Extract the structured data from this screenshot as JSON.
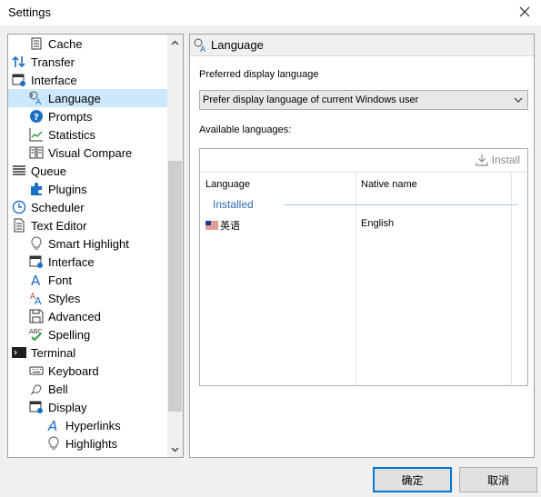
{
  "window": {
    "title": "Settings"
  },
  "tree": {
    "items": [
      {
        "label": "Cache",
        "icon": "cache-icon"
      },
      {
        "label": "Transfer",
        "icon": "transfer-icon"
      },
      {
        "label": "Interface",
        "icon": "interface-icon"
      },
      {
        "label": "Language",
        "icon": "language-icon",
        "selected": true
      },
      {
        "label": "Prompts",
        "icon": "prompts-icon"
      },
      {
        "label": "Statistics",
        "icon": "statistics-icon"
      },
      {
        "label": "Visual Compare",
        "icon": "visual-compare-icon"
      },
      {
        "label": "Queue",
        "icon": "queue-icon"
      },
      {
        "label": "Plugins",
        "icon": "plugins-icon"
      },
      {
        "label": "Scheduler",
        "icon": "scheduler-icon"
      },
      {
        "label": "Text Editor",
        "icon": "text-editor-icon"
      },
      {
        "label": "Smart Highlight",
        "icon": "smart-highlight-icon"
      },
      {
        "label": "Interface",
        "icon": "editor-interface-icon"
      },
      {
        "label": "Font",
        "icon": "font-icon"
      },
      {
        "label": "Styles",
        "icon": "styles-icon"
      },
      {
        "label": "Advanced",
        "icon": "advanced-icon"
      },
      {
        "label": "Spelling",
        "icon": "spelling-icon"
      },
      {
        "label": "Terminal",
        "icon": "terminal-icon"
      },
      {
        "label": "Keyboard",
        "icon": "keyboard-icon"
      },
      {
        "label": "Bell",
        "icon": "bell-icon"
      },
      {
        "label": "Display",
        "icon": "display-icon"
      },
      {
        "label": "Hyperlinks",
        "icon": "hyperlinks-icon"
      },
      {
        "label": "Highlights",
        "icon": "highlights-icon"
      }
    ]
  },
  "panel": {
    "title": "Language",
    "preferred_label": "Preferred display language",
    "preferred_value": "Prefer display language of current Windows user",
    "available_label": "Available languages:",
    "install_label": "Install",
    "columns": [
      "Language",
      "Native name"
    ],
    "group_label": "Installed",
    "rows": [
      {
        "language": "英语",
        "native": "English"
      }
    ]
  },
  "buttons": {
    "ok": "确定",
    "cancel": "取消"
  },
  "colors": {
    "selection": "#cce8ff",
    "accent": "#0078d7",
    "group": "#2c6db5"
  }
}
